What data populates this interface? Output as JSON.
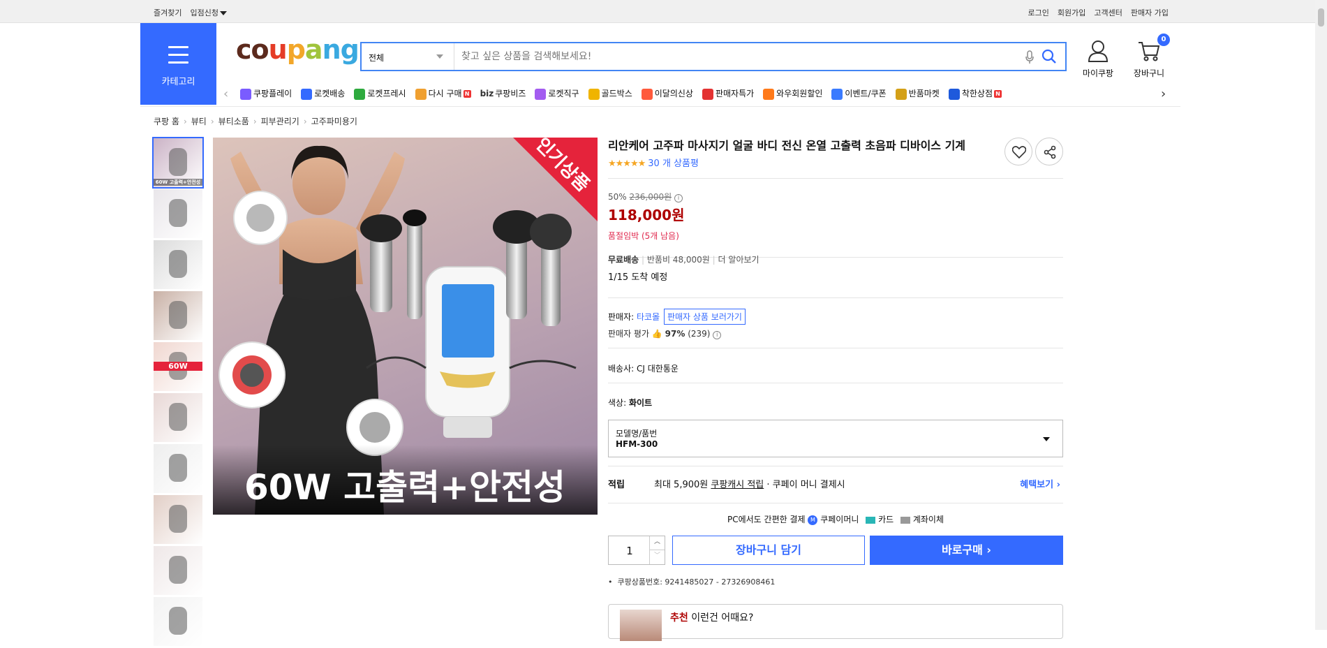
{
  "topbar": {
    "left": [
      "즐겨찾기",
      "입점신청"
    ],
    "right": [
      "로그인",
      "회원가입",
      "고객센터",
      "판매자 가입"
    ]
  },
  "header": {
    "category_label": "카테고리",
    "logo_text": "coupang",
    "logo_colors": [
      "#5c2a1d",
      "#5c2a1d",
      "#e53c27",
      "#f2a72a",
      "#a0c43c",
      "#3aa9e0",
      "#3aa9e0"
    ],
    "search_scope": "전체",
    "search_placeholder": "찾고 싶은 상품을 검색해보세요!",
    "mycoupang": "마이쿠팡",
    "cart": "장바구니",
    "cart_count": "0"
  },
  "catnav": [
    {
      "label": "쿠팡플레이",
      "icon": "play-icon",
      "color": "#7a5cff",
      "new": false
    },
    {
      "label": "로켓배송",
      "icon": "rocket-icon",
      "color": "#346aff",
      "new": false
    },
    {
      "label": "로켓프레시",
      "icon": "rocket-fresh-icon",
      "color": "#2eaa3e",
      "new": false
    },
    {
      "label": "다시 구매",
      "icon": "repurchase-icon",
      "color": "#f0a030",
      "new": true
    },
    {
      "label": "쿠팡비즈",
      "icon": "biz-icon",
      "color": "#333333",
      "new": false,
      "prefix": "biz"
    },
    {
      "label": "로켓직구",
      "icon": "global-icon",
      "color": "#a35cf0",
      "new": false
    },
    {
      "label": "골드박스",
      "icon": "goldbox-icon",
      "color": "#f0b400",
      "new": false
    },
    {
      "label": "이달의신상",
      "icon": "new-bag-icon",
      "color": "#ff5a3c",
      "new": false
    },
    {
      "label": "판매자특가",
      "icon": "seller-deal-icon",
      "color": "#e33232",
      "new": false
    },
    {
      "label": "와우회원할인",
      "icon": "wow-icon",
      "color": "#ff7a1a",
      "new": false
    },
    {
      "label": "이벤트/쿠폰",
      "icon": "coupon-icon",
      "color": "#3a7bff",
      "new": false
    },
    {
      "label": "반품마켓",
      "icon": "return-market-icon",
      "color": "#d4a017",
      "new": false
    },
    {
      "label": "착한상점",
      "icon": "good-store-icon",
      "color": "#1e5adc",
      "new": true
    }
  ],
  "breadcrumb": [
    "쿠팡 홈",
    "뷰티",
    "뷰티소품",
    "피부관리기",
    "고주파미용기"
  ],
  "product": {
    "title": "리안케어 고주파 마사지기 얼굴 바디 전신 온열 고출력 초음파 디바이스 기계",
    "rating_count": "30 개 상품평",
    "stars": 5,
    "discount": "50%",
    "original_price": "236,000원",
    "price": "118,000원",
    "stock": "품절임박 (5개 남음)",
    "shipping_free": "무료배송",
    "return_fee": "반품비 48,000원",
    "more": "더 알아보기",
    "arrival": "1/15 도착 예정",
    "seller_label": "판매자:",
    "seller_name": "타코몰",
    "seller_link": "판매자 상품 보러가기",
    "seller_rating_label": "판매자 평가",
    "seller_rating": "97%",
    "seller_rating_count": "(239)",
    "carrier_label": "배송사:",
    "carrier": "CJ 대한통운",
    "color_label": "색상:",
    "color": "화이트",
    "option_label": "모델명/품번",
    "option_value": "HFM-300",
    "reward_label": "적립",
    "reward_max": "최대 5,900원",
    "reward_link": "쿠팡캐시 적립",
    "reward_suffix": "· 쿠페이 머니 결제시",
    "benefit": "혜택보기",
    "pay_title": "PC에서도 간편한 결제",
    "pay_methods": [
      "쿠페이머니",
      "카드",
      "계좌이체"
    ],
    "quantity": "1",
    "add_cart": "장바구니 담기",
    "buy_now": "바로구매",
    "product_no": "쿠팡상품번호: 9241485027 - 27326908461",
    "rec_tag": "추천",
    "rec_text": "이런건 어때요?"
  },
  "main_image": {
    "badge": "인기상품",
    "caption": "60W 고출력+안전성"
  },
  "thumbs": [
    {
      "caption": "60W 고출력+안전성"
    },
    {
      "caption": ""
    },
    {
      "caption": ""
    },
    {
      "caption": ""
    },
    {
      "caption": "60W"
    },
    {
      "caption": ""
    },
    {
      "caption": ""
    },
    {
      "caption": ""
    },
    {
      "caption": ""
    },
    {
      "caption": ""
    }
  ]
}
